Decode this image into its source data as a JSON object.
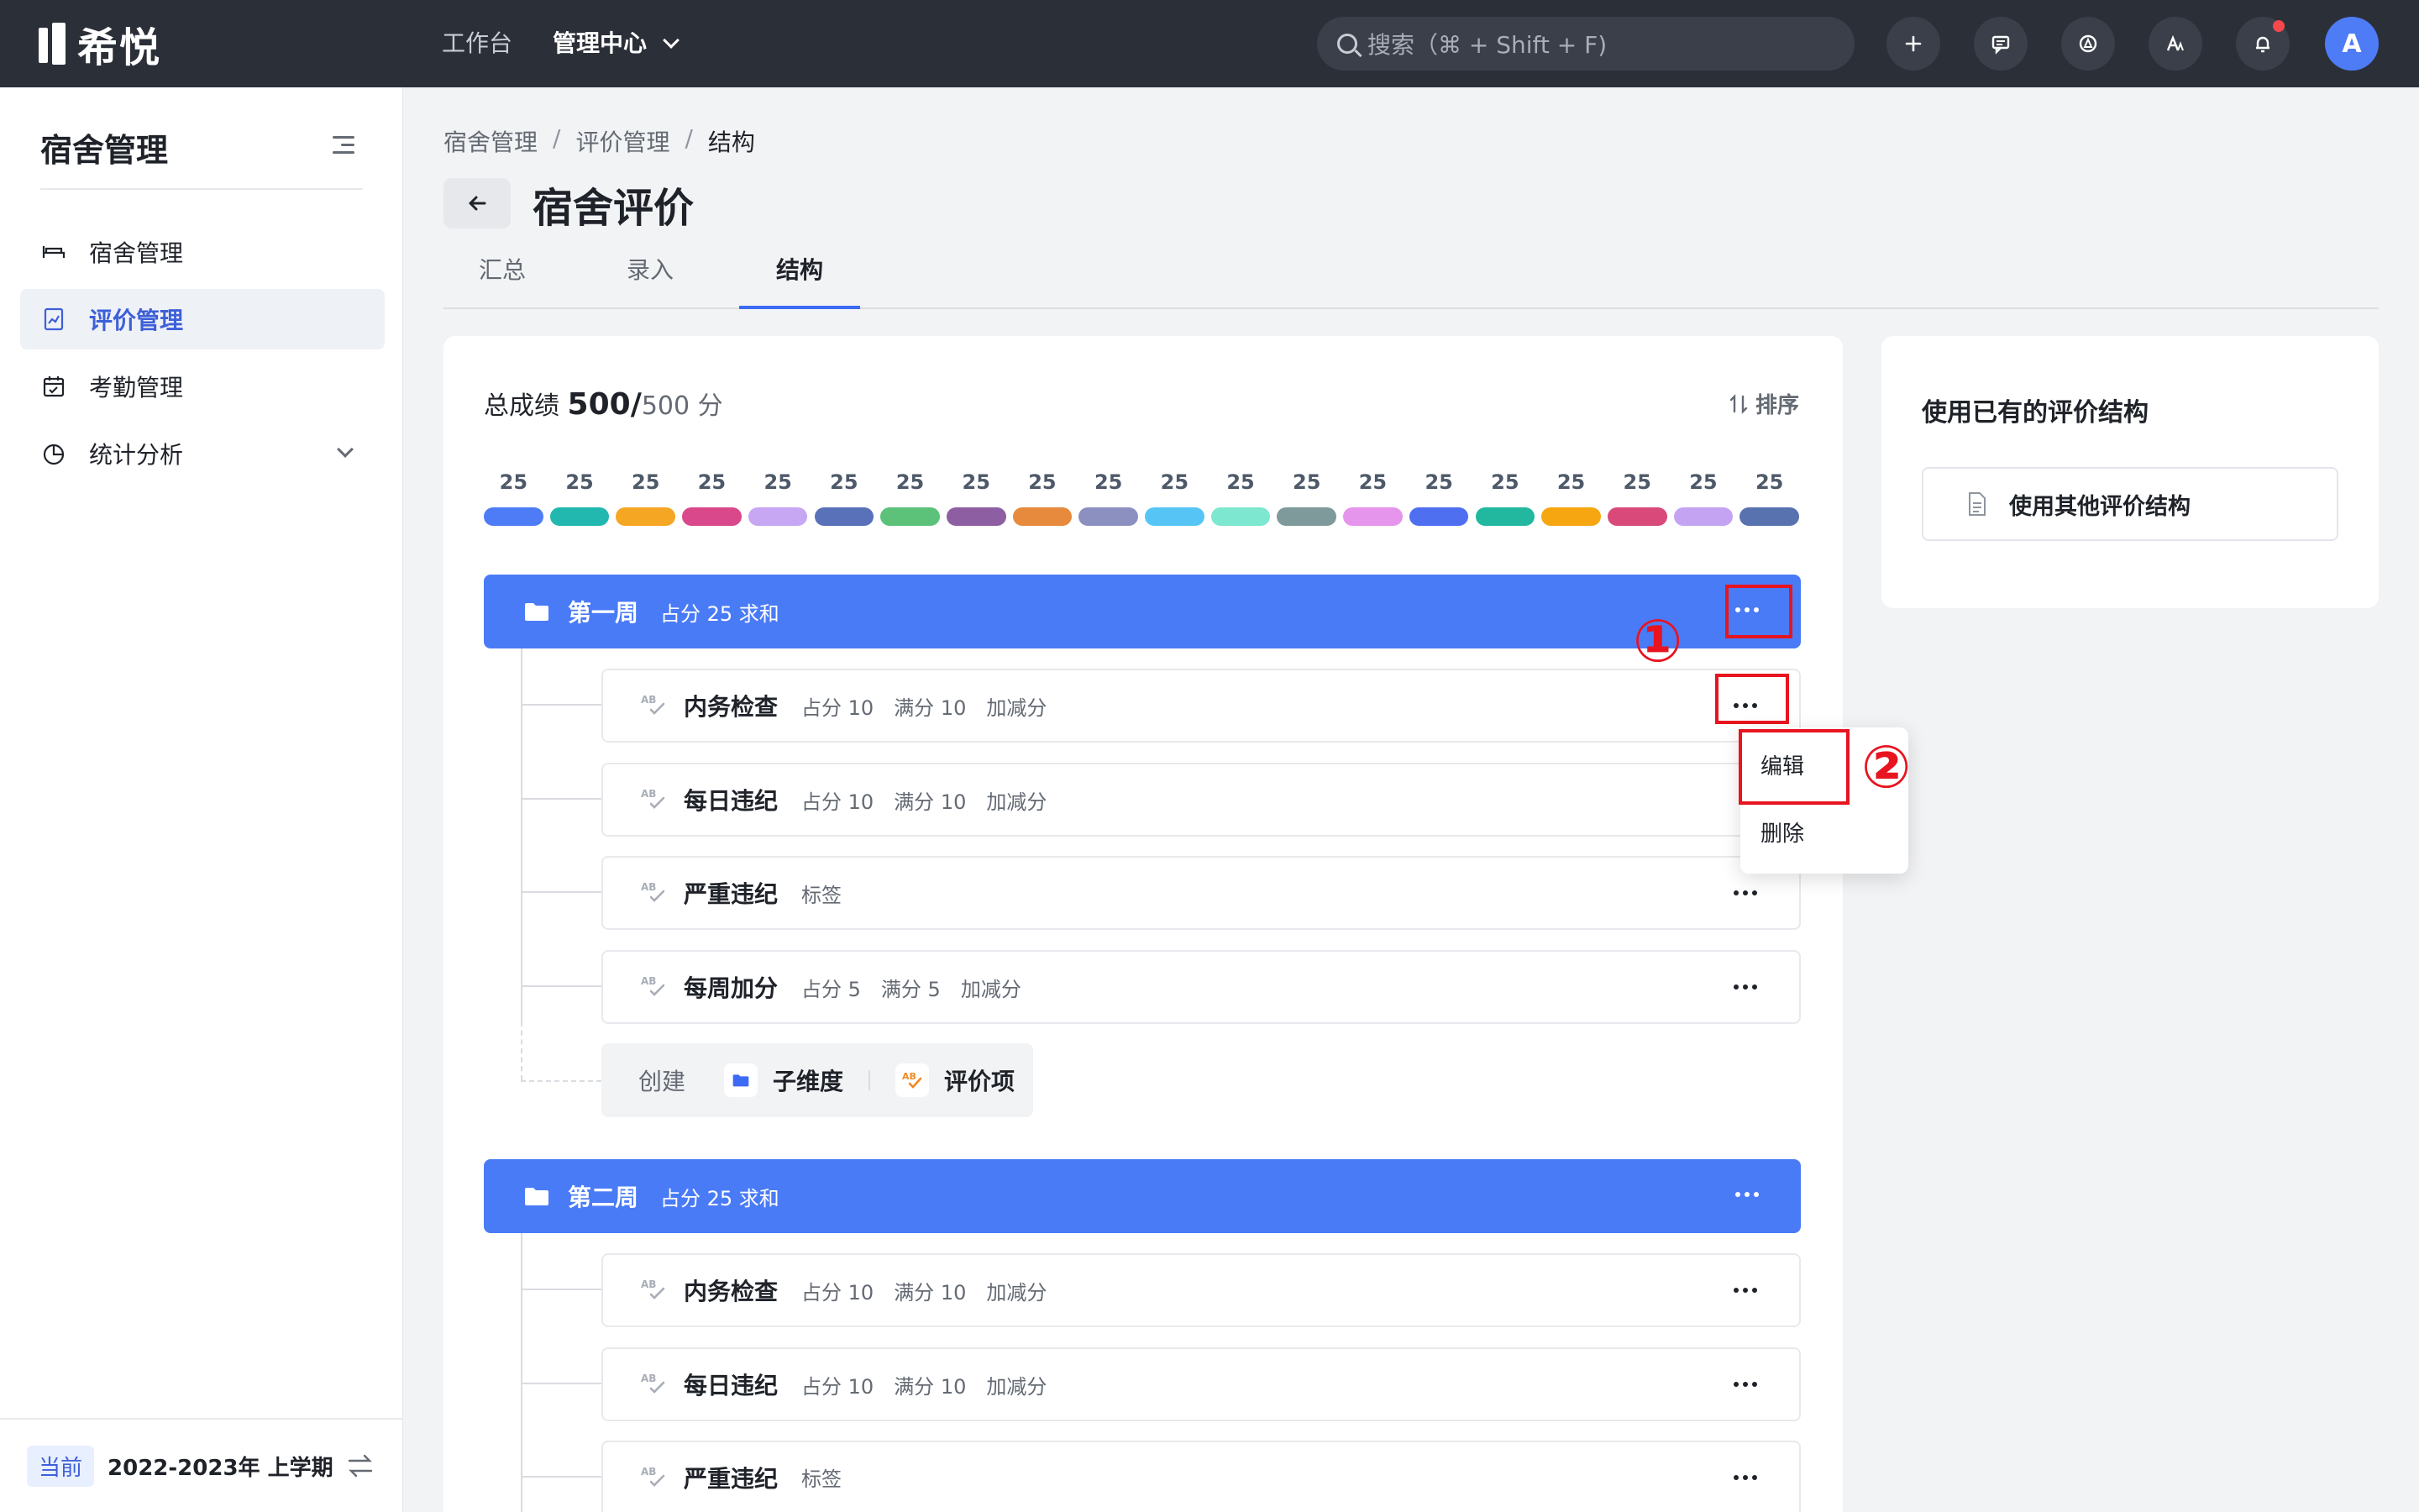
{
  "app": {
    "logo_text": "希悦"
  },
  "topnav": {
    "workbench": "工作台",
    "management": "管理中心"
  },
  "search": {
    "placeholder": "搜索（⌘ + Shift + F)"
  },
  "topbar_icons": [
    "plus-icon",
    "message-icon",
    "compass-icon",
    "translate-icon",
    "bell-icon"
  ],
  "user": {
    "avatar_letter": "A"
  },
  "sidebar": {
    "title": "宿舍管理",
    "items": [
      {
        "label": "宿舍管理",
        "icon": "bed-icon"
      },
      {
        "label": "评价管理",
        "icon": "chart-doc-icon",
        "active": true
      },
      {
        "label": "考勤管理",
        "icon": "calendar-check-icon"
      },
      {
        "label": "统计分析",
        "icon": "pie-chart-icon",
        "expandable": true
      }
    ],
    "footer": {
      "badge": "当前",
      "term": "2022-2023年 上学期"
    }
  },
  "breadcrumb": [
    "宿舍管理",
    "评价管理",
    "结构"
  ],
  "page": {
    "title": "宿舍评价"
  },
  "tabs": [
    {
      "label": "汇总"
    },
    {
      "label": "录入"
    },
    {
      "label": "结构",
      "active": true
    }
  ],
  "structure": {
    "total_label": "总成绩",
    "total_value": "500/",
    "total_max": "500 分",
    "sort_label": "排序",
    "pills": [
      {
        "value": "25",
        "color": "#4e7cf6"
      },
      {
        "value": "25",
        "color": "#22b8b0"
      },
      {
        "value": "25",
        "color": "#f5a623"
      },
      {
        "value": "25",
        "color": "#d9488a"
      },
      {
        "value": "25",
        "color": "#c7a6f4"
      },
      {
        "value": "25",
        "color": "#5871b8"
      },
      {
        "value": "25",
        "color": "#5cc27a"
      },
      {
        "value": "25",
        "color": "#8e5ea2"
      },
      {
        "value": "25",
        "color": "#e78a3e"
      },
      {
        "value": "25",
        "color": "#8c90c0"
      },
      {
        "value": "25",
        "color": "#56c5f5"
      },
      {
        "value": "25",
        "color": "#7ee7cf"
      },
      {
        "value": "25",
        "color": "#7f9a9a"
      },
      {
        "value": "25",
        "color": "#e695ec"
      },
      {
        "value": "25",
        "color": "#4e6ff0"
      },
      {
        "value": "25",
        "color": "#22b8a0"
      },
      {
        "value": "25",
        "color": "#f5a610"
      },
      {
        "value": "25",
        "color": "#d94a7a"
      },
      {
        "value": "25",
        "color": "#c4a4f2"
      },
      {
        "value": "25",
        "color": "#5872b0"
      }
    ],
    "groups": [
      {
        "name": "第一周",
        "meta": "占分 25 求和",
        "items": [
          {
            "name": "内务检查",
            "meta": [
              "占分 10",
              "满分 10",
              "加减分"
            ]
          },
          {
            "name": "每日违纪",
            "meta": [
              "占分 10",
              "满分 10",
              "加减分"
            ]
          },
          {
            "name": "严重违纪",
            "meta": [
              "标签"
            ]
          },
          {
            "name": "每周加分",
            "meta": [
              "占分 5",
              "满分 5",
              "加减分"
            ]
          }
        ],
        "create": {
          "label": "创建",
          "sub_dimension": "子维度",
          "eval_item": "评价项"
        }
      },
      {
        "name": "第二周",
        "meta": "占分 25 求和",
        "items": [
          {
            "name": "内务检查",
            "meta": [
              "占分 10",
              "满分 10",
              "加减分"
            ]
          },
          {
            "name": "每日违纪",
            "meta": [
              "占分 10",
              "满分 10",
              "加减分"
            ]
          },
          {
            "name": "严重违纪",
            "meta": [
              "标签"
            ]
          }
        ]
      }
    ]
  },
  "dropdown": {
    "edit": "编辑",
    "delete": "删除"
  },
  "annotations": {
    "one": "①",
    "two": "②"
  },
  "right_panel": {
    "title": "使用已有的评价结构",
    "button": "使用其他评价结构"
  }
}
